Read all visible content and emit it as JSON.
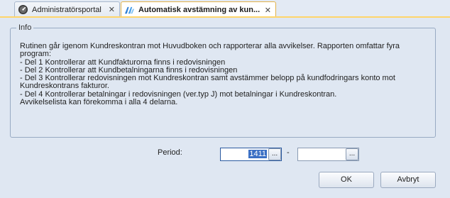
{
  "tabs": [
    {
      "label": "Administratörsportal",
      "icon": "gauge-icon",
      "close": "✕"
    },
    {
      "label": "Automatisk avstämning av kun...",
      "icon": "app-logo-icon",
      "close": "✕"
    }
  ],
  "info": {
    "title": "Info",
    "lines": [
      "Rutinen går igenom Kundreskontran mot Huvudboken och rapporterar alla avvikelser. Rapporten omfattar fyra",
      "program:",
      "- Del 1 Kontrollerar att Kundfakturorna finns i redovisningen",
      "- Del 2 Kontrollerar att Kundbetalningarna finns i redovisningen",
      "- Del 3 Kontrollerar redovisningen mot Kundreskontran samt avstämmer belopp på kundfodringars konto mot",
      "Kundreskontrans fakturor.",
      "- Del 4 Kontrollerar betalningar i redovisningen (ver.typ J) mot betalningar i Kundreskontran.",
      "Avvikelselista kan förekomma i alla 4 delarna."
    ]
  },
  "period": {
    "label": "Period:",
    "from_value": "1411",
    "to_value": "",
    "separator": "-",
    "browse_label": "..."
  },
  "buttons": {
    "ok": "OK",
    "cancel": "Avbryt"
  }
}
